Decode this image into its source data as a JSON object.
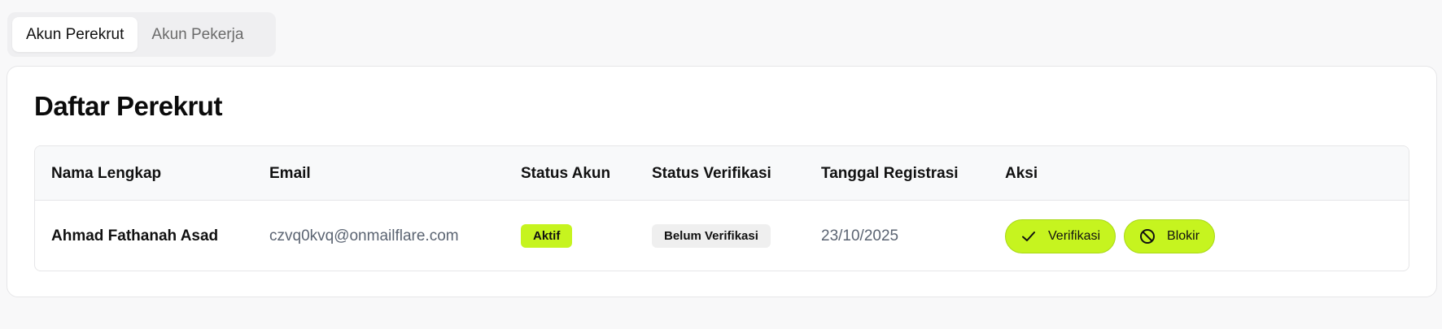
{
  "tabs": [
    {
      "label": "Akun Perekrut",
      "active": true
    },
    {
      "label": "Akun Pekerja",
      "active": false
    }
  ],
  "card": {
    "title": "Daftar Perekrut"
  },
  "table": {
    "headers": [
      "Nama Lengkap",
      "Email",
      "Status Akun",
      "Status Verifikasi",
      "Tanggal Registrasi",
      "Aksi"
    ],
    "rows": [
      {
        "name": "Ahmad Fathanah Asad",
        "email": "czvq0kvq@onmailflare.com",
        "account_status": "Aktif",
        "verification_status": "Belum Verifikasi",
        "registered": "23/10/2025",
        "actions": {
          "verify_label": "Verifikasi",
          "verify_icon": "check-icon",
          "block_label": "Blokir",
          "block_icon": "ban-icon"
        }
      }
    ]
  },
  "colors": {
    "accent": "#c6f41f",
    "background": "#f8f8f9"
  }
}
